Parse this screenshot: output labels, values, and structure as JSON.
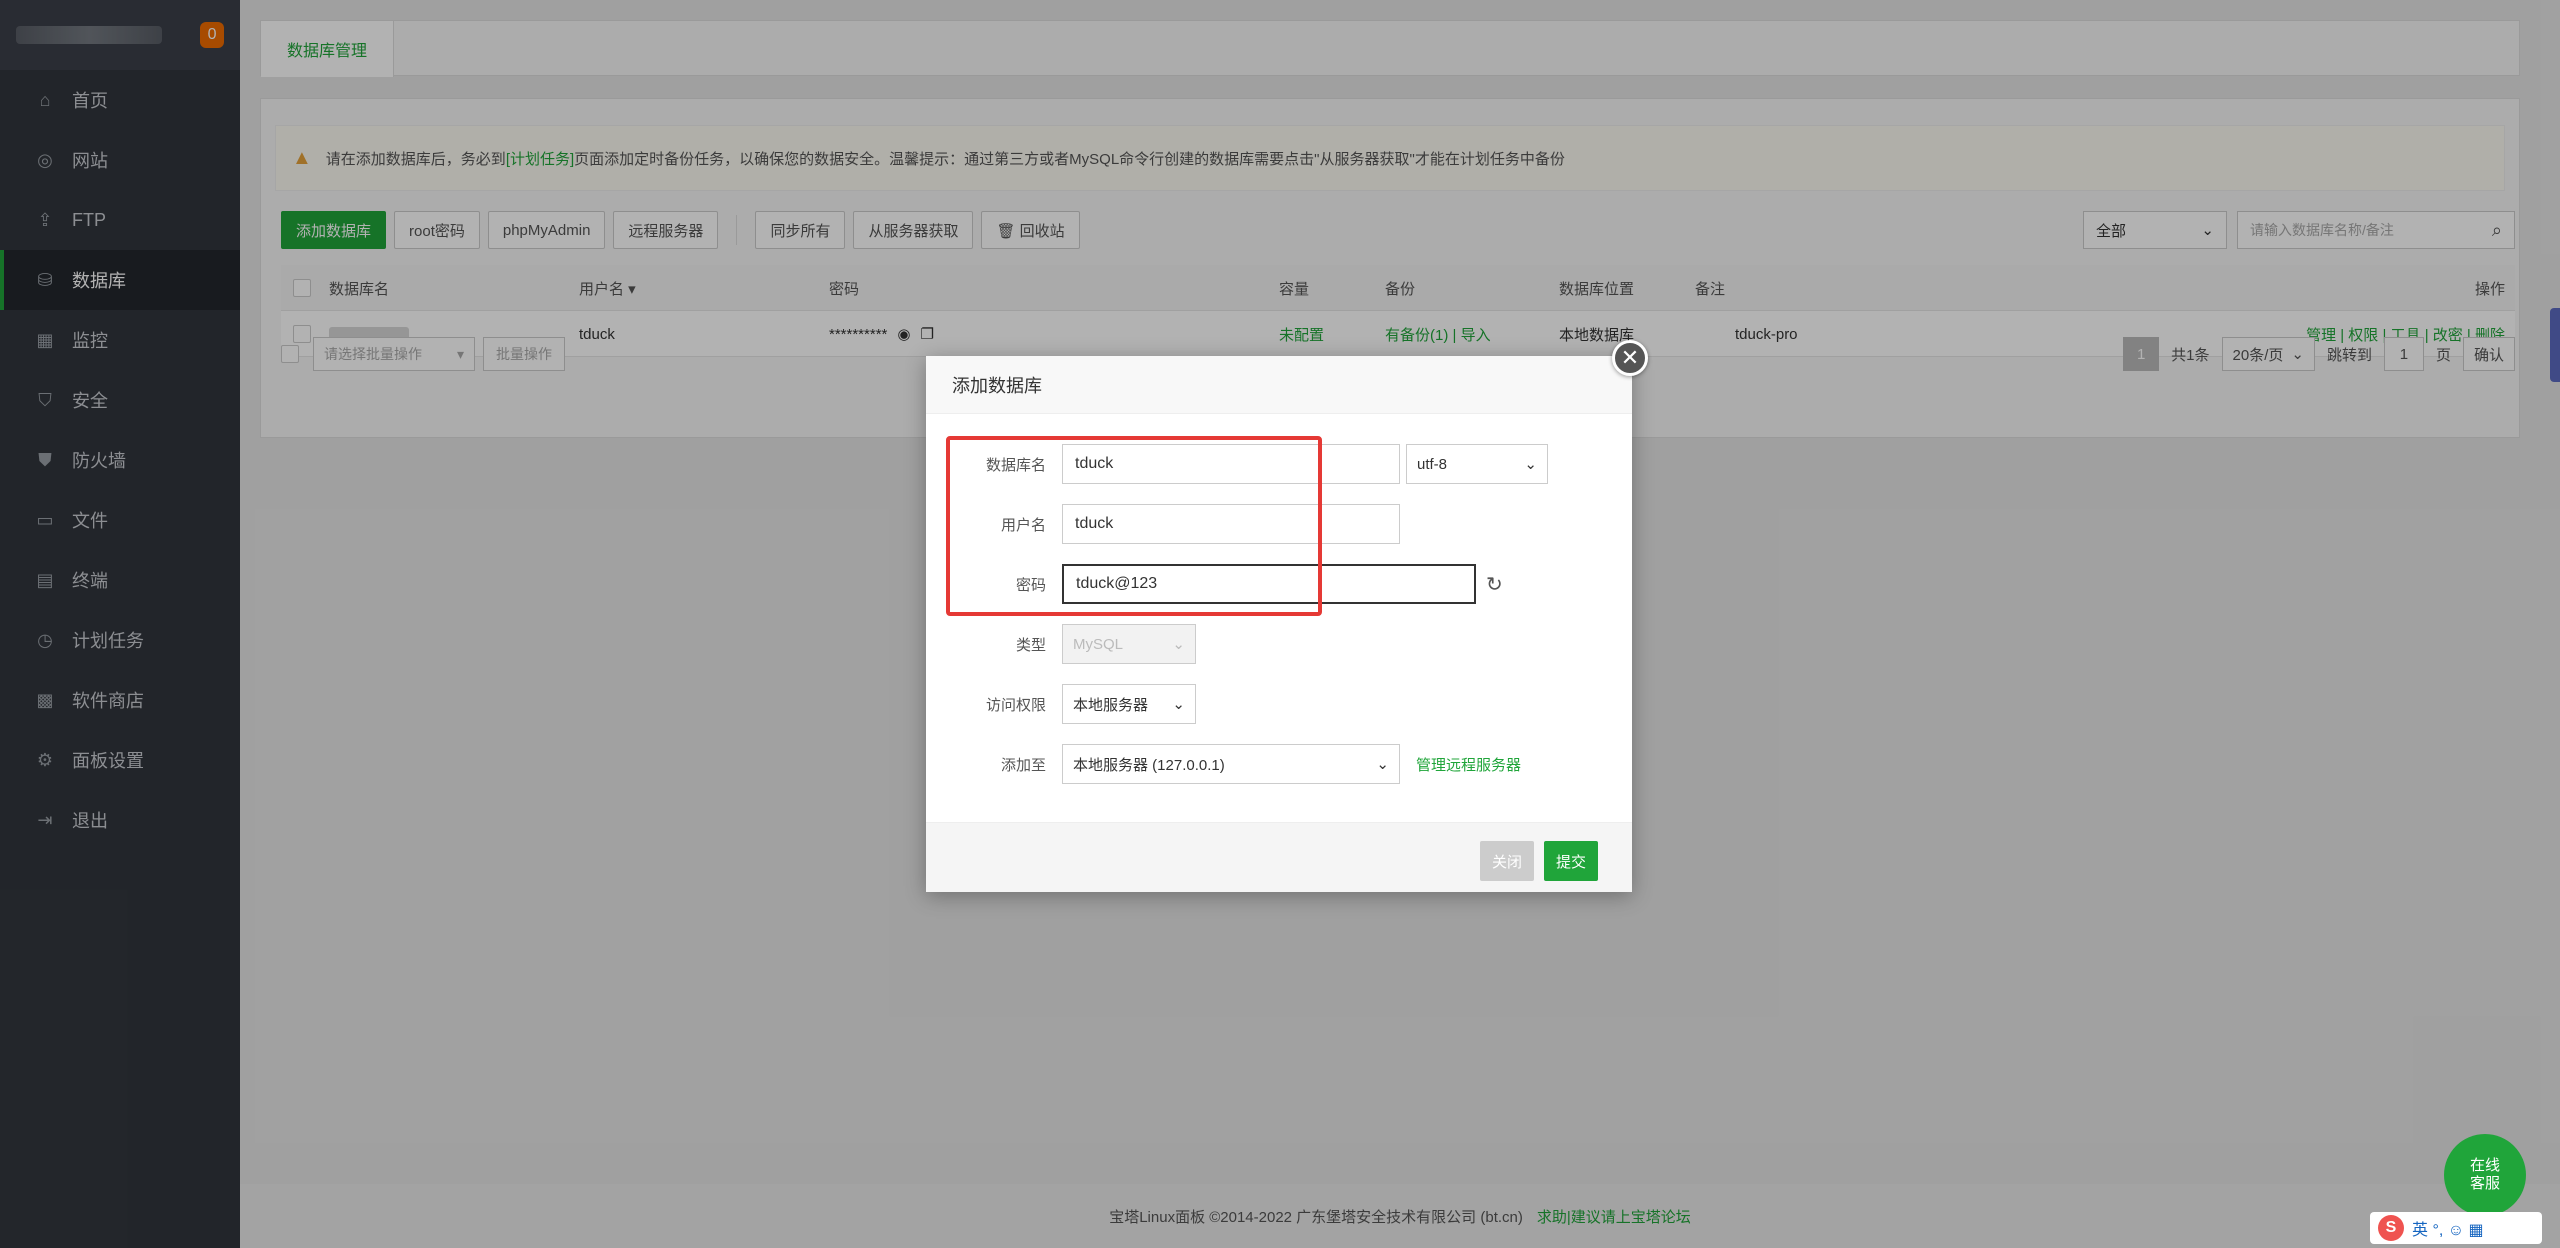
{
  "sidebar": {
    "badge": "0",
    "items": [
      {
        "label": "首页",
        "icon": "⌂"
      },
      {
        "label": "网站",
        "icon": "◎"
      },
      {
        "label": "FTP",
        "icon": "⇪"
      },
      {
        "label": "数据库",
        "icon": "⛁"
      },
      {
        "label": "监控",
        "icon": "▦"
      },
      {
        "label": "安全",
        "icon": "⛉"
      },
      {
        "label": "防火墙",
        "icon": "⛊"
      },
      {
        "label": "文件",
        "icon": "▭"
      },
      {
        "label": "终端",
        "icon": "▤"
      },
      {
        "label": "计划任务",
        "icon": "◷"
      },
      {
        "label": "软件商店",
        "icon": "▩"
      },
      {
        "label": "面板设置",
        "icon": "⚙"
      },
      {
        "label": "退出",
        "icon": "⇥"
      }
    ]
  },
  "tab": {
    "label": "数据库管理"
  },
  "notice": {
    "prefix": "请在添加数据库后，务必到",
    "link": "[计划任务]",
    "suffix": "页面添加定时备份任务，以确保您的数据安全。温馨提示：通过第三方或者MySQL命令行创建的数据库需要点击\"从服务器获取\"才能在计划任务中备份"
  },
  "toolbar": {
    "add_db": "添加数据库",
    "root_pwd": "root密码",
    "phpmyadmin": "phpMyAdmin",
    "remote": "远程服务器",
    "sync_all": "同步所有",
    "fetch_server": "从服务器获取",
    "recycle": "🗑 回收站",
    "filter": "全部",
    "search_placeholder": "请输入数据库名称/备注"
  },
  "table": {
    "headers": {
      "name": "数据库名",
      "user": "用户名 ▾",
      "password": "密码",
      "capacity": "容量",
      "backup": "备份",
      "location": "数据库位置",
      "note": "备注",
      "ops": "操作"
    },
    "row": {
      "user": "tduck",
      "password": "**********",
      "capacity": "未配置",
      "backup": "有备份(1) | 导入",
      "location": "本地数据库",
      "note": "tduck-pro",
      "ops": "管理 | 权限 | 工具 | 改密 | 删除"
    }
  },
  "batch": {
    "select": "请选择批量操作",
    "button": "批量操作"
  },
  "pager": {
    "page": "1",
    "total": "共1条",
    "per_page": "20条/页",
    "goto": "跳转到",
    "goto_value": "1",
    "page_unit": "页",
    "confirm": "确认"
  },
  "footer": {
    "copyright": "宝塔Linux面板 ©2014-2022 广东堡塔安全技术有限公司 (bt.cn)",
    "link": "求助|建议请上宝塔论坛"
  },
  "modal": {
    "title": "添加数据库",
    "fields": {
      "db_name_label": "数据库名",
      "db_name_value": "tduck",
      "charset": "utf-8",
      "user_label": "用户名",
      "user_value": "tduck",
      "password_label": "密码",
      "password_value": "tduck@123",
      "type_label": "类型",
      "type_value": "MySQL",
      "access_label": "访问权限",
      "access_value": "本地服务器",
      "add_to_label": "添加至",
      "add_to_value": "本地服务器 (127.0.0.1)",
      "manage_remote": "管理远程服务器"
    },
    "close": "关闭",
    "submit": "提交"
  },
  "chat": {
    "label": "在线\n客服"
  },
  "ime": {
    "text": "英 °, ☺ ▦"
  }
}
